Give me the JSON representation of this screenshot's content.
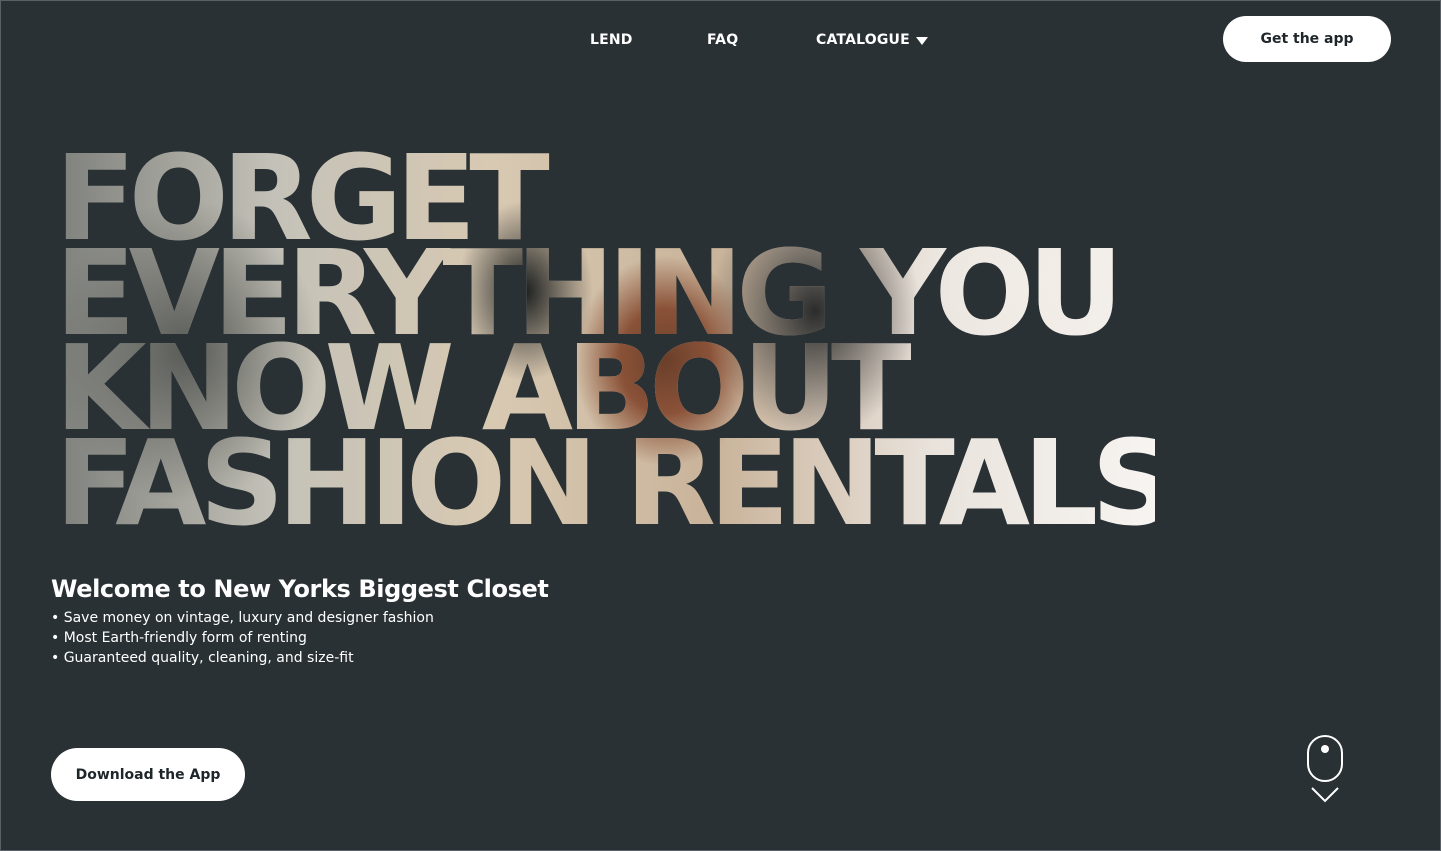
{
  "nav": {
    "lend_label": "LEND",
    "faq_label": "FAQ",
    "catalogue_label": "CATALOGUE",
    "get_app_label": "Get the app"
  },
  "hero": {
    "headline_lines": [
      "FORGET",
      "EVERYTHING YOU",
      "KNOW ABOUT",
      "FASHION RENTALS"
    ],
    "welcome": "Welcome to New Yorks Biggest Closet",
    "bullets": [
      "• Save money on vintage, luxury and designer fashion",
      "• Most Earth-friendly form of renting",
      "• Guaranteed quality, cleaning, and size-fit"
    ],
    "download_label": "Download the App"
  },
  "colors": {
    "background": "#293135",
    "button_bg": "#ffffff",
    "button_text": "#1e2629"
  },
  "icons": {
    "catalogue_caret": "caret-down-icon",
    "scroll": "mouse-scroll-icon"
  }
}
